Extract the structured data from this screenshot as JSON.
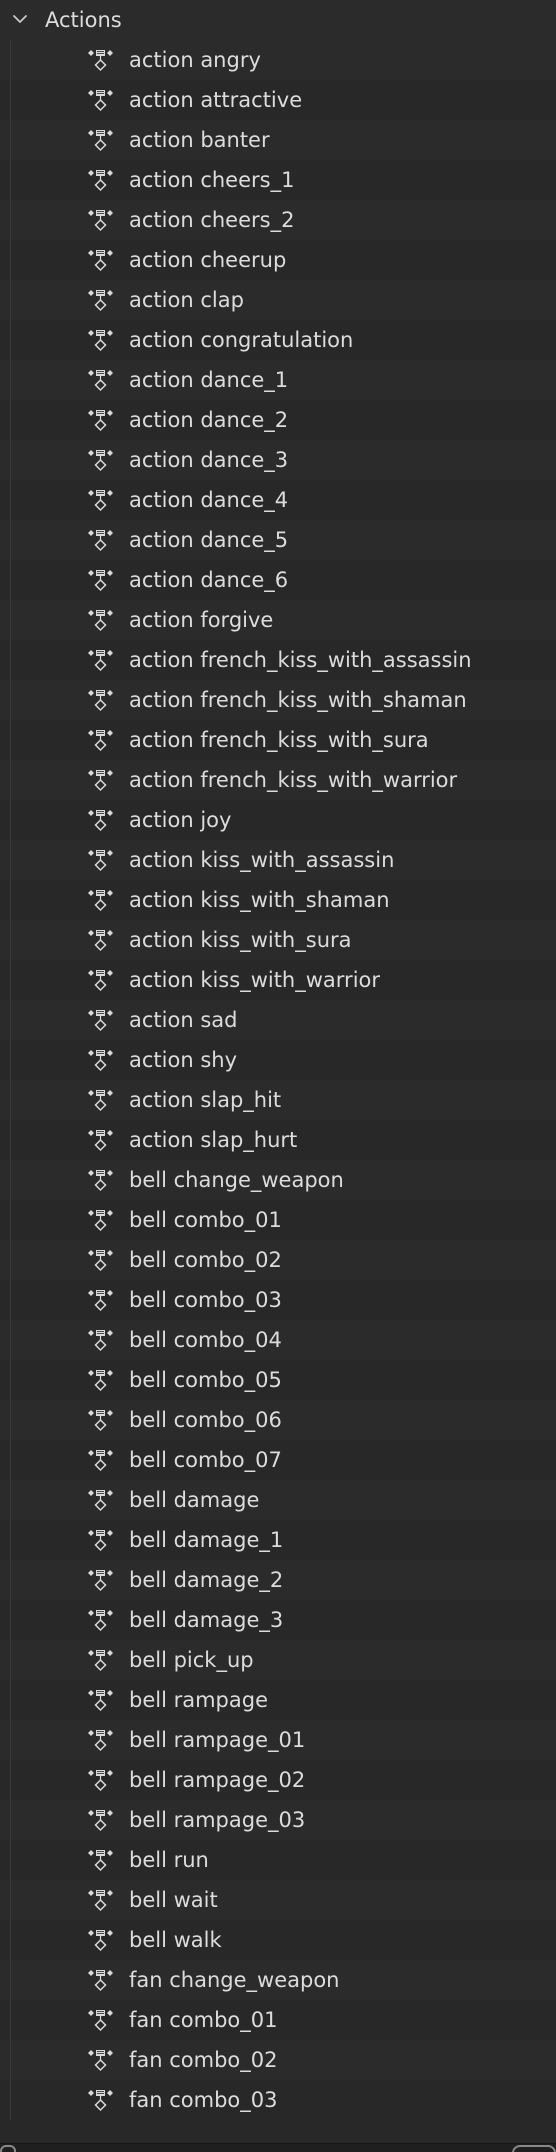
{
  "section": {
    "label": "Actions",
    "expanded": true,
    "chevron_icon": "chevron-down-icon"
  },
  "item_icon": "action-keyframes-icon",
  "items": [
    {
      "label": "action angry"
    },
    {
      "label": "action attractive"
    },
    {
      "label": "action banter"
    },
    {
      "label": "action cheers_1"
    },
    {
      "label": "action cheers_2"
    },
    {
      "label": "action cheerup"
    },
    {
      "label": "action clap"
    },
    {
      "label": "action congratulation"
    },
    {
      "label": "action dance_1"
    },
    {
      "label": "action dance_2"
    },
    {
      "label": "action dance_3"
    },
    {
      "label": "action dance_4"
    },
    {
      "label": "action dance_5"
    },
    {
      "label": "action dance_6"
    },
    {
      "label": "action forgive"
    },
    {
      "label": "action french_kiss_with_assassin"
    },
    {
      "label": "action french_kiss_with_shaman"
    },
    {
      "label": "action french_kiss_with_sura"
    },
    {
      "label": "action french_kiss_with_warrior"
    },
    {
      "label": "action joy"
    },
    {
      "label": "action kiss_with_assassin"
    },
    {
      "label": "action kiss_with_shaman"
    },
    {
      "label": "action kiss_with_sura"
    },
    {
      "label": "action kiss_with_warrior"
    },
    {
      "label": "action sad"
    },
    {
      "label": "action shy"
    },
    {
      "label": "action slap_hit"
    },
    {
      "label": "action slap_hurt"
    },
    {
      "label": "bell change_weapon"
    },
    {
      "label": "bell combo_01"
    },
    {
      "label": "bell combo_02"
    },
    {
      "label": "bell combo_03"
    },
    {
      "label": "bell combo_04"
    },
    {
      "label": "bell combo_05"
    },
    {
      "label": "bell combo_06"
    },
    {
      "label": "bell combo_07"
    },
    {
      "label": "bell damage"
    },
    {
      "label": "bell damage_1"
    },
    {
      "label": "bell damage_2"
    },
    {
      "label": "bell damage_3"
    },
    {
      "label": "bell pick_up"
    },
    {
      "label": "bell rampage"
    },
    {
      "label": "bell rampage_01"
    },
    {
      "label": "bell rampage_02"
    },
    {
      "label": "bell rampage_03"
    },
    {
      "label": "bell run"
    },
    {
      "label": "bell wait"
    },
    {
      "label": "bell walk"
    },
    {
      "label": "fan change_weapon"
    },
    {
      "label": "fan combo_01"
    },
    {
      "label": "fan combo_02"
    },
    {
      "label": "fan combo_03"
    }
  ]
}
